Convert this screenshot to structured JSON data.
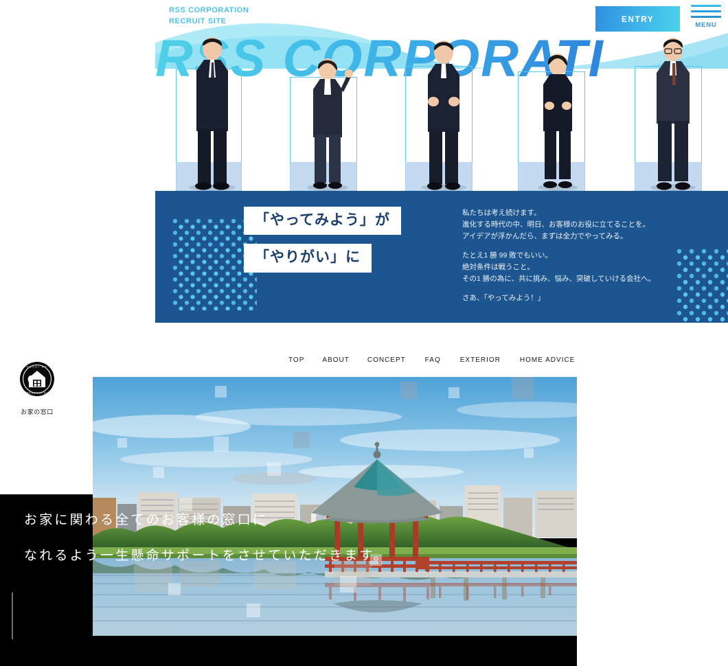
{
  "recruit": {
    "brand_line1": "RSS CORPORATION",
    "brand_line2": "RECRUIT SITE",
    "entry_label": "ENTRY",
    "menu_label": "MENU",
    "wordmark": "RSS CORPORATI",
    "headline_line1": "「やってみよう」が",
    "headline_line2": "「やりがい」に",
    "copy": [
      "私たちは考え続けます。\n進化する時代の中、明日、お客様のお役に立てることを。\nアイデアが浮かんだら、まずは全力でやってみる。",
      "たとえ1 勝 99 敗でもいい。\n絶対条件は戦うこと。\nその1 勝の為に、共に挑み、悩み、突破していける会社へ。",
      "さあ、「やってみよう！」"
    ],
    "copy_lines": {
      "p1l1": "私たちは考え続けます。",
      "p1l2": "進化する時代の中、明日、お客様のお役に立てることを。",
      "p1l3": "アイデアが浮かんだら、まずは全力でやってみる。",
      "p2l1": "たとえ1 勝 99 敗でもいい。",
      "p2l2": "絶対条件は戦うこと。",
      "p2l3": "その1 勝の為に、共に挑み、悩み、突破していける会社へ。",
      "p3l1": "さあ、「やってみよう！」"
    },
    "colors": {
      "navy": "#1d5590",
      "cyan": "#4bc2ef",
      "entry_gradient_start": "#2f8fe0",
      "entry_gradient_end": "#4bd3ea",
      "headline_text": "#1b3f6d",
      "dot_color": "#4fb8e8"
    },
    "people_count": 5
  },
  "home_window": {
    "logo_caption": "お家の窓口",
    "logo_badge_top": "OUCHI NO",
    "logo_badge_bottom": "MADOGUCHI",
    "nav": [
      {
        "label": "TOP"
      },
      {
        "label": "ABOUT"
      },
      {
        "label": "CONCEPT"
      },
      {
        "label": "FAQ"
      },
      {
        "label": "EXTERIOR"
      },
      {
        "label": "HOME ADVICE"
      }
    ],
    "tagline_line1": "お家に関わる全てのお客様の窓口に",
    "tagline_line2": "なれるよう一生懸命サポートをさせていただきます。",
    "colors": {
      "background": "#000000",
      "text": "#ffffff",
      "nav_text": "#1a1a1a"
    },
    "photo_description": "Japanese lakeside pavilion with city skyline"
  }
}
